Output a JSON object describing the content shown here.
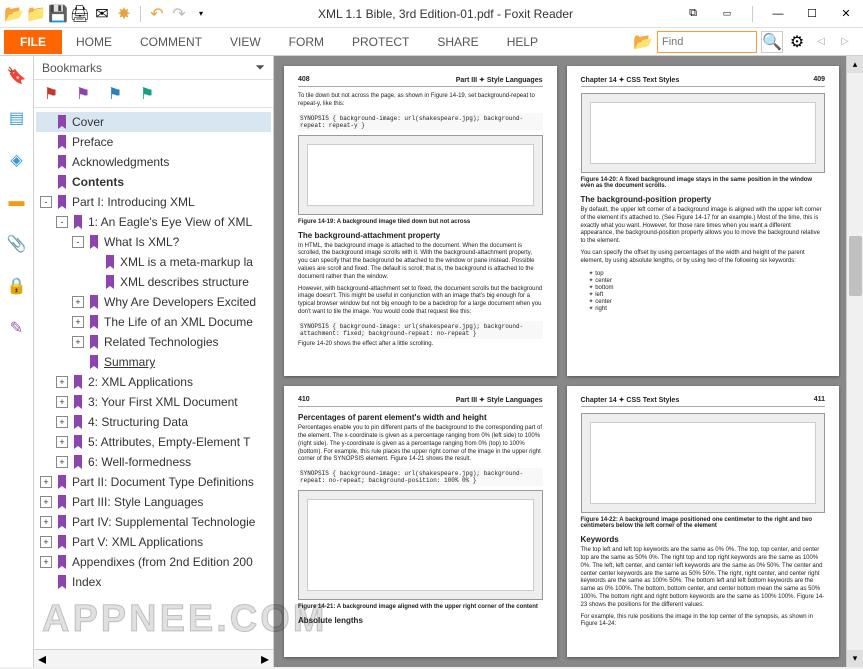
{
  "window": {
    "title": "XML 1.1 Bible, 3rd Edition-01.pdf - Foxit Reader"
  },
  "ribbon": {
    "file": "FILE",
    "tabs": [
      "HOME",
      "COMMENT",
      "VIEW",
      "FORM",
      "PROTECT",
      "SHARE",
      "HELP"
    ],
    "find_placeholder": "Find"
  },
  "bookmarks": {
    "header": "Bookmarks",
    "items": [
      {
        "level": 1,
        "label": "Cover",
        "expander": null,
        "selected": true
      },
      {
        "level": 1,
        "label": "Preface",
        "expander": null
      },
      {
        "level": 1,
        "label": "Acknowledgments",
        "expander": null
      },
      {
        "level": 1,
        "label": "Contents",
        "expander": null,
        "bold": true
      },
      {
        "level": 1,
        "label": "Part I: Introducing XML",
        "expander": "-"
      },
      {
        "level": 2,
        "label": "1: An Eagle's Eye View of XML",
        "expander": "-"
      },
      {
        "level": 3,
        "label": "What Is XML?",
        "expander": "-"
      },
      {
        "level": 4,
        "label": "XML is a meta-markup la",
        "expander": null
      },
      {
        "level": 4,
        "label": "XML describes structure",
        "expander": null
      },
      {
        "level": 3,
        "label": "Why Are Developers Excited",
        "expander": "+"
      },
      {
        "level": 3,
        "label": "The Life of an XML Docume",
        "expander": "+"
      },
      {
        "level": 3,
        "label": "Related Technologies",
        "expander": "+"
      },
      {
        "level": 3,
        "label": "Summary",
        "expander": null,
        "underline": true
      },
      {
        "level": 2,
        "label": "2: XML Applications",
        "expander": "+"
      },
      {
        "level": 2,
        "label": "3: Your First XML Document",
        "expander": "+"
      },
      {
        "level": 2,
        "label": "4: Structuring Data",
        "expander": "+"
      },
      {
        "level": 2,
        "label": "5: Attributes, Empty-Element T",
        "expander": "+"
      },
      {
        "level": 2,
        "label": "6: Well-formedness",
        "expander": "+"
      },
      {
        "level": 1,
        "label": "Part II: Document Type Definitions",
        "expander": "+"
      },
      {
        "level": 1,
        "label": "Part III: Style Languages",
        "expander": "+"
      },
      {
        "level": 1,
        "label": "Part IV: Supplemental Technologie",
        "expander": "+"
      },
      {
        "level": 1,
        "label": "Part V: XML Applications",
        "expander": "+"
      },
      {
        "level": 1,
        "label": "Appendixes (from 2nd Edition 200",
        "expander": "+"
      },
      {
        "level": 1,
        "label": "Index",
        "expander": null
      }
    ]
  },
  "pages": [
    {
      "num": "408",
      "part": "Part III ✦ Style Languages",
      "intro": "To tile down but not across the page, as shown in Figure 14-19, set background-repeat to repeat-y, like this:",
      "code1": "SYNOPSIS { background-image: url(shakespeare.jpg);\n           background-repeat: repeat-y }",
      "caption1": "Figure 14-19: A background image tiled down but not across",
      "h1": "The background-attachment property",
      "p1": "In HTML, the background image is attached to the document. When the document is scrolled, the background image scrolls with it. With the background-attachment property, you can specify that the background be attached to the window or pane instead. Possible values are scroll and fixed. The default is scroll; that is, the background is attached to the document rather than the window.",
      "p2": "However, with background-attachment set to fixed, the document scrolls but the background image doesn't. This might be useful in conjunction with an image that's big enough for a typical browser window but not big enough to be a backdrop for a large document when you don't want to tile the image. You would code that request like this:",
      "code2": "SYNOPSIS { background-image: url(shakespeare.jpg);\n           background-attachment: fixed;\n           background-repeat: no-repeat }",
      "caption2": "Figure 14-20 shows the effect after a little scrolling."
    },
    {
      "num": "409",
      "part": "Chapter 14 ✦ CSS Text Styles",
      "caption1": "Figure 14-20: A fixed background image stays in the same position in the window even as the document scrolls.",
      "h1": "The background-position property",
      "p1": "By default, the upper left corner of a background image is aligned with the upper left corner of the element it's attached to. (See Figure 14-17 for an example.) Most of the time, this is exactly what you want. However, for those rare times when you want a different appearance, the background-position property allows you to move the background relative to the element.",
      "p2": "You can specify the offset by using percentages of the width and height of the parent element, by using absolute lengths, or by using two of the following six keywords:",
      "list": [
        "top",
        "center",
        "bottom",
        "left",
        "center",
        "right"
      ]
    },
    {
      "num": "410",
      "part": "Part III ✦ Style Languages",
      "h1": "Percentages of parent element's width and height",
      "p1": "Percentages enable you to pin different parts of the background to the corresponding part of the element. The x-coordinate is given as a percentage ranging from 0% (left side) to 100% (right side). The y-coordinate is given as a percentage ranging from 0% (top) to 100% (bottom). For example, this rule places the upper right corner of the image in the upper right corner of the SYNOPSIS element. Figure 14-21 shows the result.",
      "code1": "SYNOPSIS { background-image: url(shakespeare.jpg);\n           background-repeat: no-repeat;\n           background-position: 100% 0% }",
      "caption1": "Figure 14-21: A background image aligned with the upper right corner of the content",
      "h2": "Absolute lengths"
    },
    {
      "num": "411",
      "part": "Chapter 14 ✦ CSS Text Styles",
      "caption1": "Figure 14-22: A background image positioned one centimeter to the right and two centimeters below the left corner of the element",
      "h1": "Keywords",
      "p1": "The top left and left top keywords are the same as 0% 0%. The top, top center, and center top are the same as 50% 0%. The right top and top right keywords are the same as 100% 0%. The left, left center, and center left keywords are the same as 0% 50%. The center and center center keywords are the same as 50% 50%. The right, right center, and center right keywords are the same as 100% 50%. The bottom left and left bottom keywords are the same as 0% 100%. The bottom, bottom center, and center bottom mean the same as 50% 100%. The bottom right and right bottom keywords are the same as 100% 100%. Figure 14-23 shows the positions for the different values.",
      "p2": "For example, this rule positions the image in the top center of the synopsis, as shown in Figure 14-24:"
    }
  ],
  "watermark": "APPNEE.COM"
}
